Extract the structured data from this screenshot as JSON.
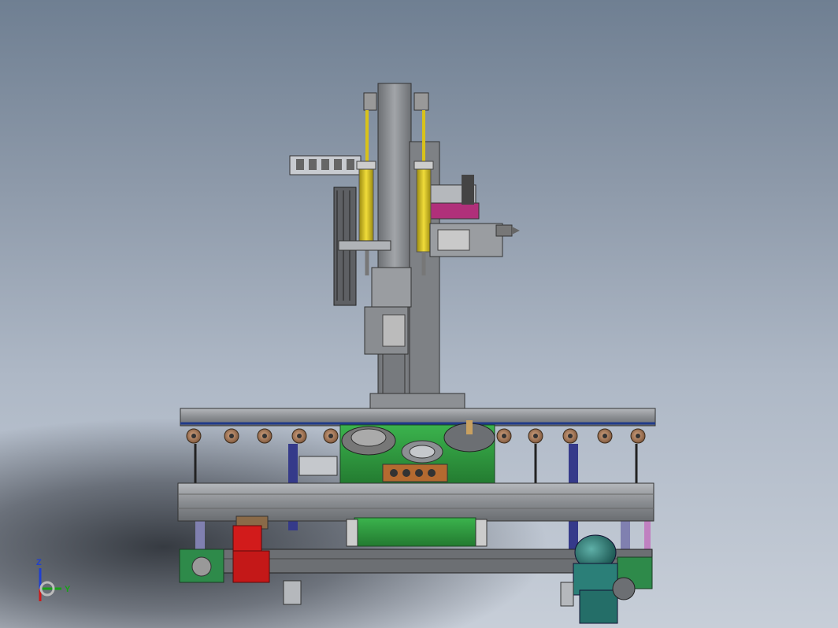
{
  "viewport": {
    "background_top": "#6f7f92",
    "background_bottom": "#c7ced8"
  },
  "triad": {
    "z_label": "Z",
    "y_label": "Y",
    "z_color": "#1f3fd0",
    "y_color": "#18a018",
    "x_color": "#d01818"
  },
  "colors": {
    "frame": "#8d9094",
    "cylinder": "#d8c21a",
    "green_plate": "#2fa040",
    "red_motor": "#d21b1b",
    "teal_motor": "#2b7f78",
    "magenta_plate": "#b0307a",
    "roller": "#a8795a"
  }
}
